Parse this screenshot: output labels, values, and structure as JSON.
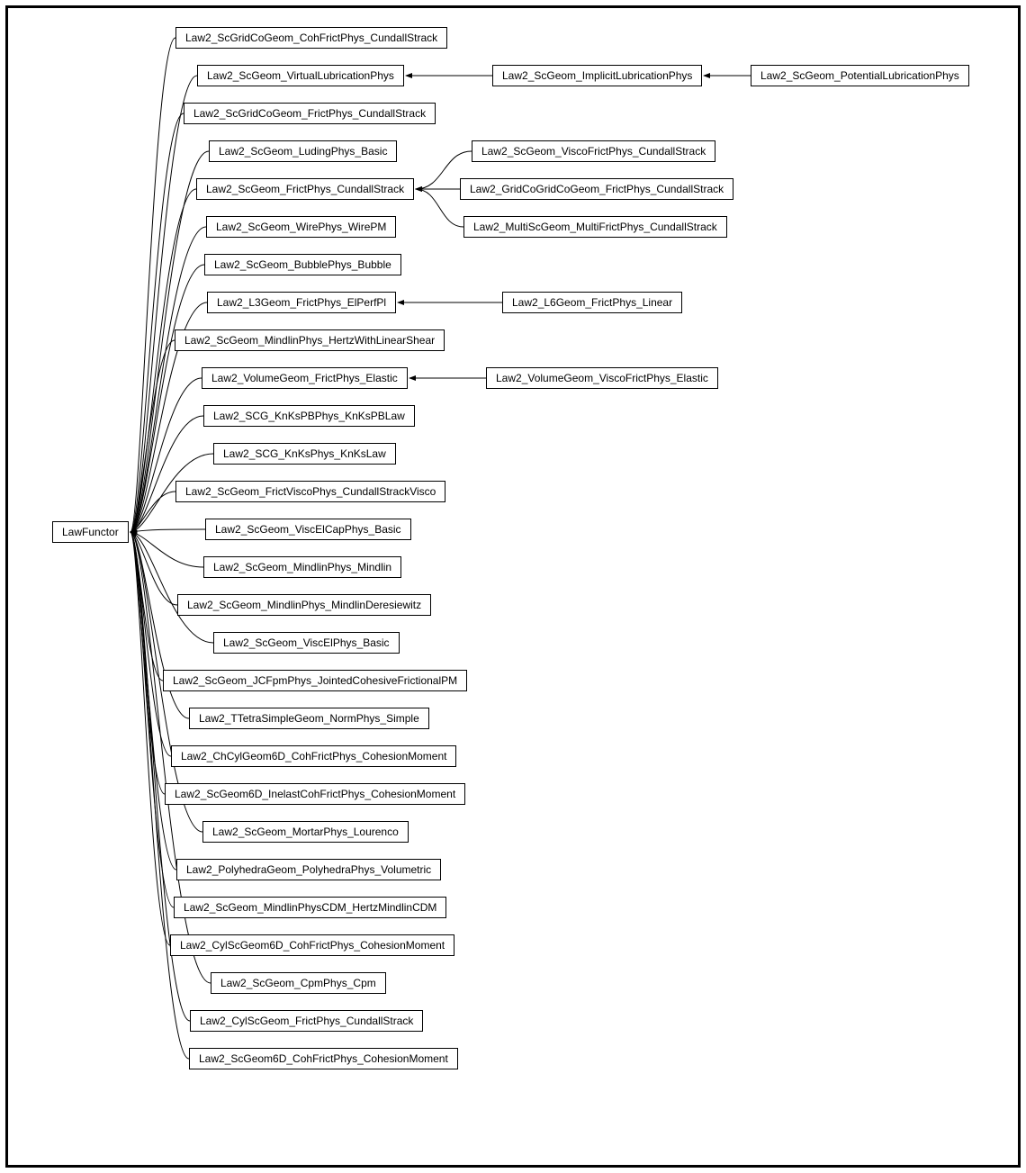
{
  "diagram": {
    "root": "LawFunctor",
    "nodes": {
      "n0": "Law2_ScGridCoGeom_CohFrictPhys_CundallStrack",
      "n1": "Law2_ScGeom_VirtualLubricationPhys",
      "n2": "Law2_ScGeom_ImplicitLubricationPhys",
      "n3": "Law2_ScGeom_PotentialLubricationPhys",
      "n4": "Law2_ScGridCoGeom_FrictPhys_CundallStrack",
      "n5": "Law2_ScGeom_LudingPhys_Basic",
      "n6": "Law2_ScGeom_ViscoFrictPhys_CundallStrack",
      "n7": "Law2_ScGeom_FrictPhys_CundallStrack",
      "n8": "Law2_GridCoGridCoGeom_FrictPhys_CundallStrack",
      "n9": "Law2_ScGeom_WirePhys_WirePM",
      "n10": "Law2_MultiScGeom_MultiFrictPhys_CundallStrack",
      "n11": "Law2_ScGeom_BubblePhys_Bubble",
      "n12": "Law2_L3Geom_FrictPhys_ElPerfPl",
      "n13": "Law2_L6Geom_FrictPhys_Linear",
      "n14": "Law2_ScGeom_MindlinPhys_HertzWithLinearShear",
      "n15": "Law2_VolumeGeom_FrictPhys_Elastic",
      "n16": "Law2_VolumeGeom_ViscoFrictPhys_Elastic",
      "n17": "Law2_SCG_KnKsPBPhys_KnKsPBLaw",
      "n18": "Law2_SCG_KnKsPhys_KnKsLaw",
      "n19": "Law2_ScGeom_FrictViscoPhys_CundallStrackVisco",
      "n20": "Law2_ScGeom_ViscElCapPhys_Basic",
      "n21": "Law2_ScGeom_MindlinPhys_Mindlin",
      "n22": "Law2_ScGeom_MindlinPhys_MindlinDeresiewitz",
      "n23": "Law2_ScGeom_ViscElPhys_Basic",
      "n24": "Law2_ScGeom_JCFpmPhys_JointedCohesiveFrictionalPM",
      "n25": "Law2_TTetraSimpleGeom_NormPhys_Simple",
      "n26": "Law2_ChCylGeom6D_CohFrictPhys_CohesionMoment",
      "n27": "Law2_ScGeom6D_InelastCohFrictPhys_CohesionMoment",
      "n28": "Law2_ScGeom_MortarPhys_Lourenco",
      "n29": "Law2_PolyhedraGeom_PolyhedraPhys_Volumetric",
      "n30": "Law2_ScGeom_MindlinPhysCDM_HertzMindlinCDM",
      "n31": "Law2_CylScGeom6D_CohFrictPhys_CohesionMoment",
      "n32": "Law2_ScGeom_CpmPhys_Cpm",
      "n33": "Law2_CylScGeom_FrictPhys_CundallStrack",
      "n34": "Law2_ScGeom6D_CohFrictPhys_CohesionMoment"
    }
  }
}
